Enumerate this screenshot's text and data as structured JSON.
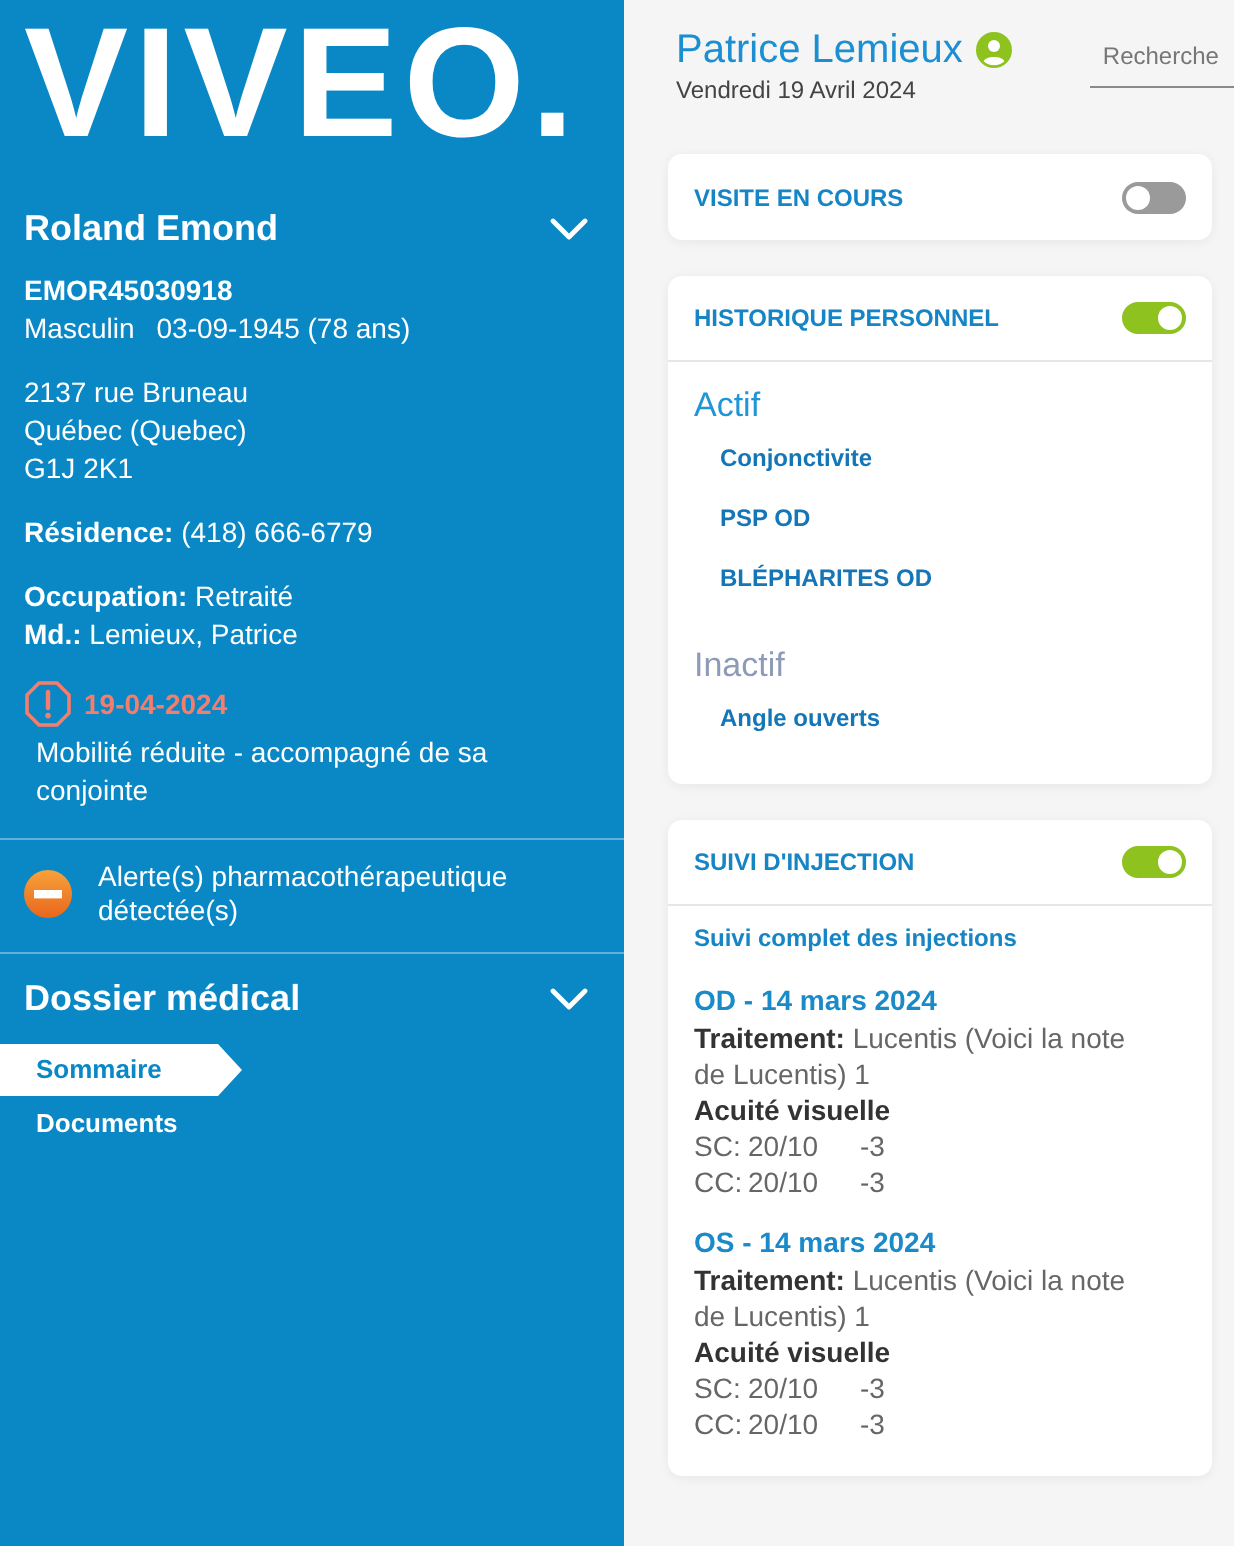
{
  "sidebar": {
    "logo": "VIVEO.",
    "patient": {
      "name": "Roland Emond",
      "file_number": "EMOR45030918",
      "sex": "Masculin",
      "birth": "03-09-1945 (78 ans)",
      "address": [
        "2137 rue Bruneau",
        "Québec (Quebec)",
        "G1J 2K1"
      ],
      "residence": "**Résidence:** (418) 666-6779",
      "work": [
        "**Occupation:** Retraité",
        "**Md.:** Lemieux, Patrice"
      ]
    },
    "note": {
      "date": "19-04-2024",
      "text": "Mobilité réduite - accompagné de sa conjointe"
    },
    "alert": {
      "text": "Alerte(s) pharmacothérapeutique détectée(s)"
    },
    "section": {
      "title": "Dossier médical",
      "items": [
        {
          "label": "Sommaire",
          "selected": true
        },
        {
          "label": "Documents",
          "selected": false
        }
      ]
    }
  },
  "header": {
    "user": "Patrice Lemieux",
    "date": "Vendredi 19 Avril 2024",
    "search": {
      "placeholder": "Recherche"
    }
  },
  "cards": [
    {
      "kind": "toggle",
      "title": "VISITE EN COURS",
      "on": false
    },
    {
      "kind": "history",
      "title": "HISTORIQUE PERSONNEL",
      "on": true,
      "groups": [
        {
          "heading": "Actif",
          "active": true,
          "items": [
            "Conjonctivite",
            "PSP OD",
            "BLÉPHARITES OD"
          ]
        },
        {
          "heading": "Inactif",
          "active": false,
          "items": [
            "Angle ouverts"
          ]
        }
      ]
    },
    {
      "kind": "injections",
      "title": "SUIVI D'INJECTION",
      "on": true,
      "link": "Suivi complet des injections",
      "entries": [
        {
          "title": "OD - 14 mars 2024",
          "treatment": "**Traitement:** Lucentis (Voici la note de Lucentis) 1",
          "acuity_label": "Acuité visuelle",
          "rows": [
            {
              "label": "SC:",
              "value": "20/10",
              "delta": "-3"
            },
            {
              "label": "CC:",
              "value": "20/10",
              "delta": "-3"
            }
          ]
        },
        {
          "title": "OS - 14 mars 2024",
          "treatment": "**Traitement:** Lucentis (Voici la note de Lucentis) 1",
          "acuity_label": "Acuité visuelle",
          "rows": [
            {
              "label": "SC:",
              "value": "20/10",
              "delta": "-3"
            },
            {
              "label": "CC:",
              "value": "20/10",
              "delta": "-3"
            }
          ]
        }
      ]
    }
  ]
}
